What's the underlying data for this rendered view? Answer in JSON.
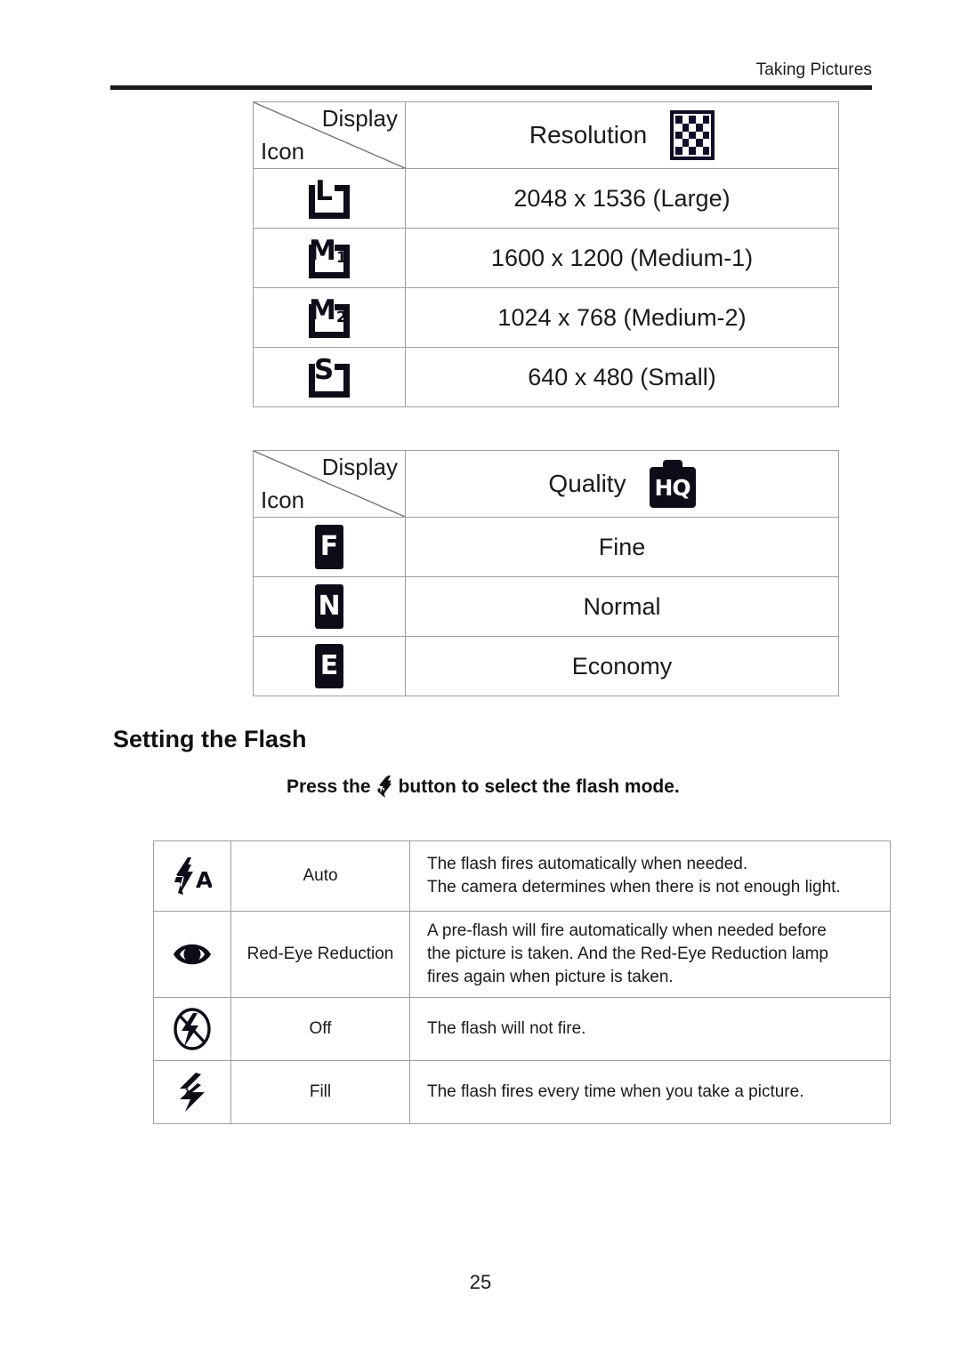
{
  "header": {
    "running_head": "Taking Pictures"
  },
  "resolution_table": {
    "corner": {
      "display_label": "Display",
      "icon_label": "Icon"
    },
    "title": "Resolution",
    "title_icon": "checkerboard-icon",
    "rows": [
      {
        "icon_letter": "L",
        "icon_sub": "",
        "value": "2048 x 1536 (Large)"
      },
      {
        "icon_letter": "M",
        "icon_sub": "1",
        "value": "1600 x 1200 (Medium-1)"
      },
      {
        "icon_letter": "M",
        "icon_sub": "2",
        "value": "1024 x 768 (Medium-2)"
      },
      {
        "icon_letter": "S",
        "icon_sub": "",
        "value": "640 x 480 (Small)"
      }
    ]
  },
  "quality_table": {
    "corner": {
      "display_label": "Display",
      "icon_label": "Icon"
    },
    "title": "Quality",
    "title_icon": "hq-camera-icon",
    "title_icon_text": "HQ",
    "rows": [
      {
        "icon_letter": "F",
        "value": "Fine"
      },
      {
        "icon_letter": "N",
        "value": "Normal"
      },
      {
        "icon_letter": "E",
        "value": "Economy"
      }
    ]
  },
  "flash_section": {
    "heading": "Setting the Flash",
    "subtitle_before": "Press the",
    "subtitle_icon": "flash-bolt-icon",
    "subtitle_after": "button to select the flash mode.",
    "rows": [
      {
        "icon": "flash-auto-icon",
        "name": "Auto",
        "desc_lines": [
          "The flash fires automatically when needed.",
          "The camera determines when there is not enough light."
        ]
      },
      {
        "icon": "red-eye-icon",
        "name": "Red-Eye Reduction",
        "desc_lines": [
          "A pre-flash will fire automatically when needed before",
          "the picture is taken. And the Red-Eye Reduction lamp",
          "fires again when picture is taken."
        ]
      },
      {
        "icon": "flash-off-icon",
        "name": "Off",
        "desc_lines": [
          "The flash will not fire."
        ]
      },
      {
        "icon": "flash-fill-icon",
        "name": "Fill",
        "desc_lines": [
          "The flash fires every time when you take a picture."
        ]
      }
    ]
  },
  "footer": {
    "page_number": "25"
  },
  "colors": {
    "ink": "#1a1a1a",
    "rule": "#1a1a1a",
    "table_border": "#98a0a6",
    "icon_black": "#0d0d1a",
    "page_background": "#ffffff"
  }
}
